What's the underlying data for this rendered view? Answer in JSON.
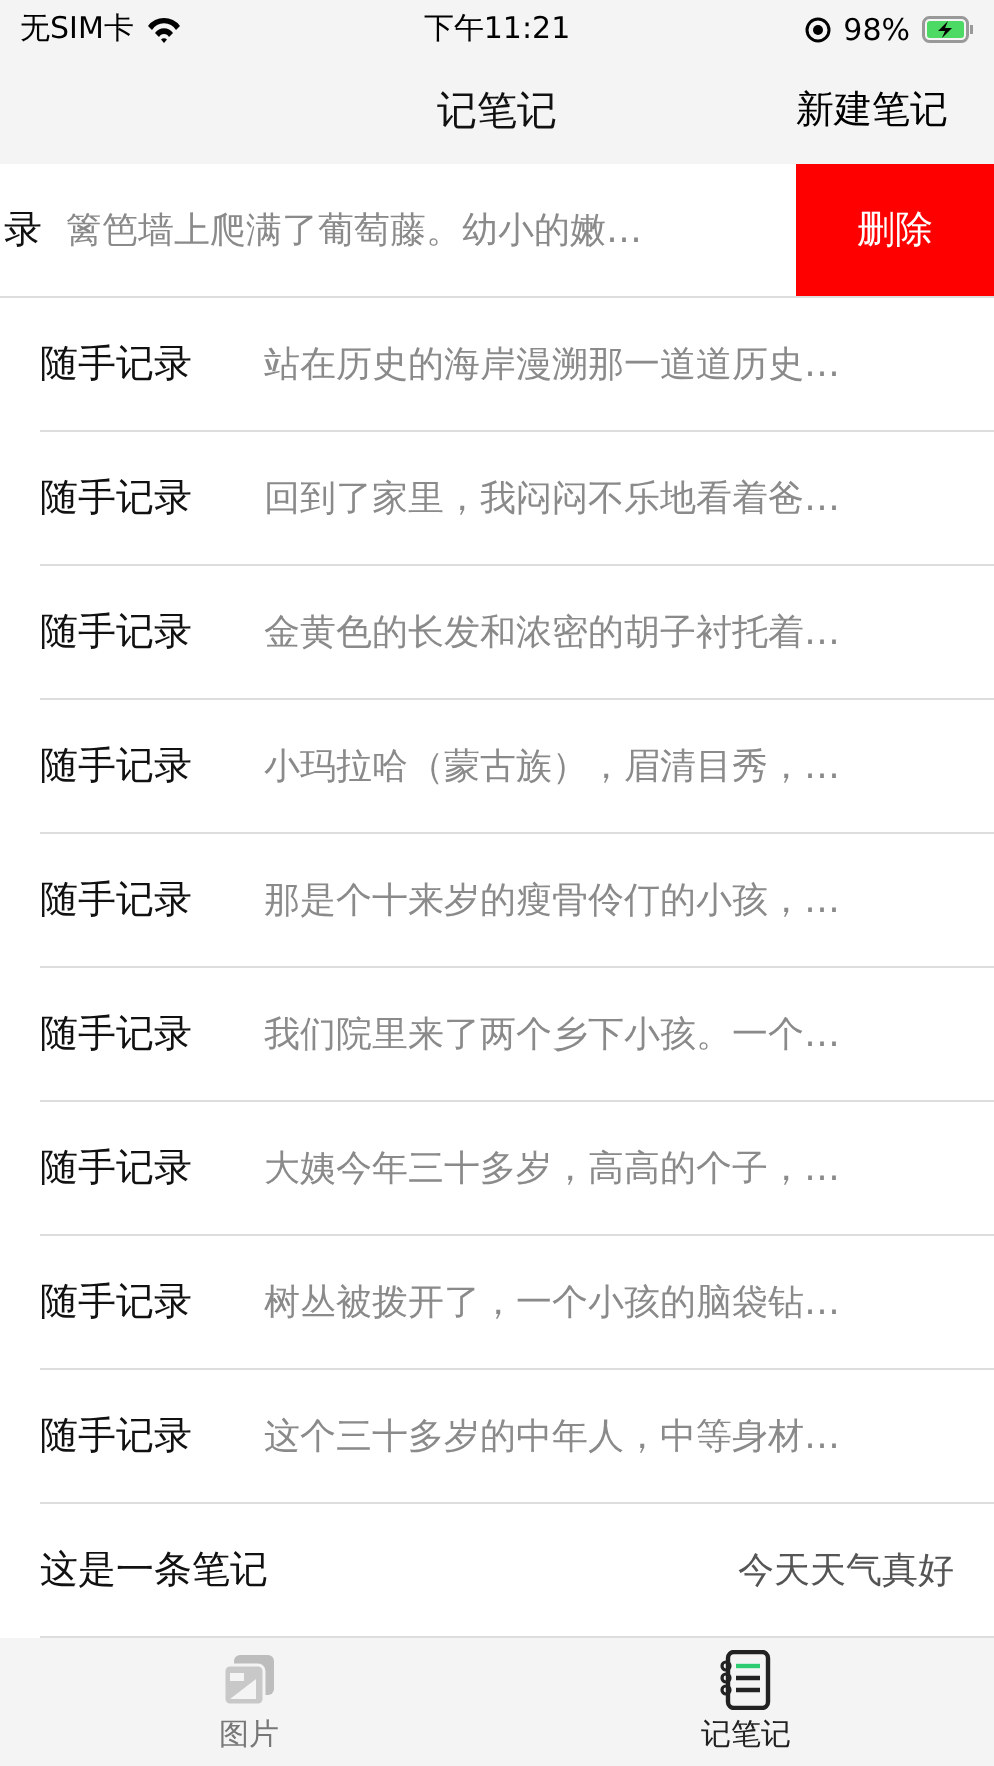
{
  "status_bar": {
    "carrier": "无SIM卡",
    "time": "下午11:21",
    "battery": "98%"
  },
  "nav": {
    "title": "记笔记",
    "action": "新建笔记"
  },
  "notes": [
    {
      "kind": "swiped",
      "title": "录",
      "preview": "篱笆墙上爬满了葡萄藤。幼小的嫩…",
      "action": "删除"
    },
    {
      "kind": "note",
      "title": "随手记录",
      "preview": "站在历史的海岸漫溯那一道道历史…"
    },
    {
      "kind": "note",
      "title": "随手记录",
      "preview": "回到了家里，我闷闷不乐地看着爸…"
    },
    {
      "kind": "note",
      "title": "随手记录",
      "preview": "金黄色的长发和浓密的胡子衬托着…"
    },
    {
      "kind": "note",
      "title": "随手记录",
      "preview": "小玛拉哈（蒙古族），眉清目秀，…"
    },
    {
      "kind": "note",
      "title": "随手记录",
      "preview": "那是个十来岁的瘦骨伶仃的小孩，…"
    },
    {
      "kind": "note",
      "title": "随手记录",
      "preview": "我们院里来了两个乡下小孩。一个…"
    },
    {
      "kind": "note",
      "title": "随手记录",
      "preview": "大姨今年三十多岁，高高的个子，…"
    },
    {
      "kind": "note",
      "title": "随手记录",
      "preview": "树丛被拨开了，一个小孩的脑袋钻…"
    },
    {
      "kind": "note",
      "title": "随手记录",
      "preview": "这个三十多岁的中年人，中等身材…"
    },
    {
      "kind": "plain",
      "title": "这是一条笔记",
      "preview": "今天天气真好"
    }
  ],
  "tabs": [
    {
      "label": "图片",
      "selected": false
    },
    {
      "label": "记笔记",
      "selected": true
    }
  ]
}
